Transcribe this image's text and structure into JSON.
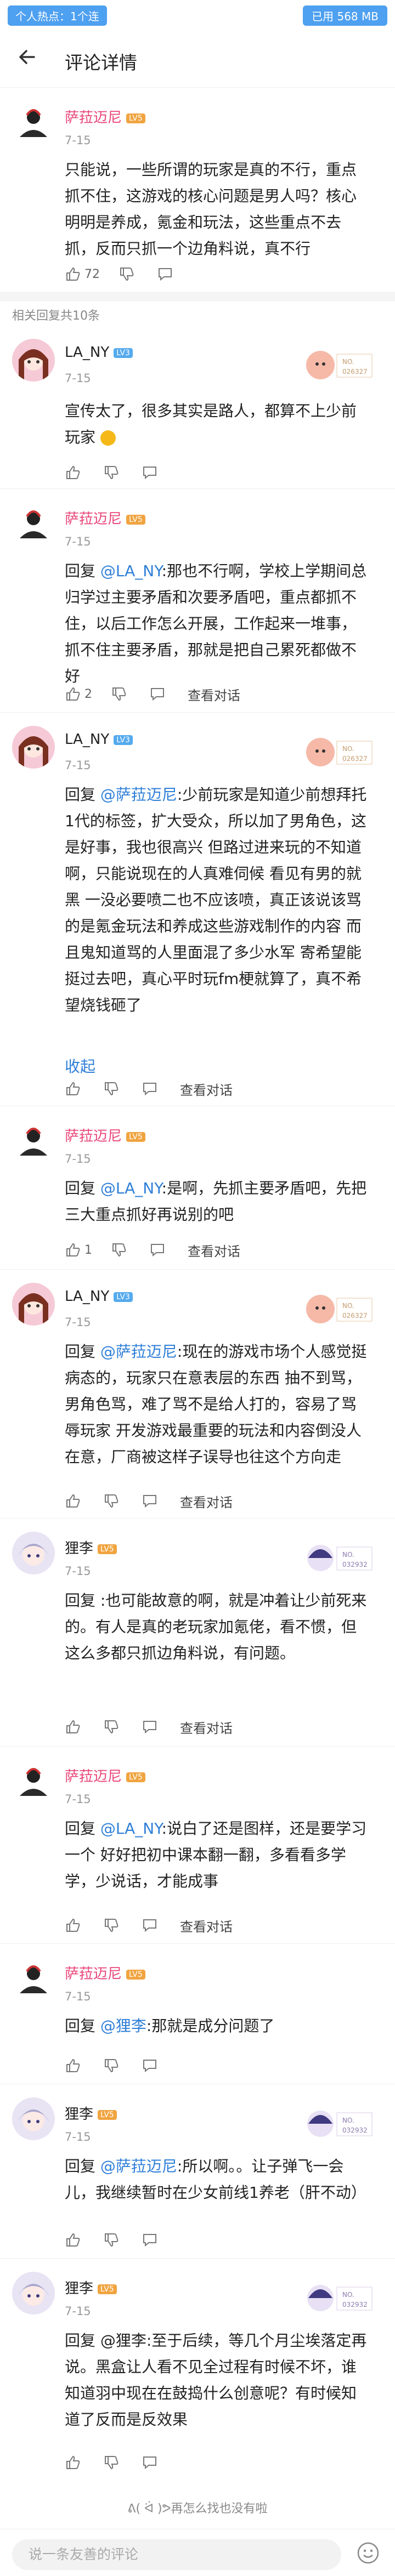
{
  "statusbar": {
    "left": "个人热点：1个连",
    "right": "已用 568 MB"
  },
  "header": {
    "title": "评论详情"
  },
  "main_comment": {
    "user": "萨菈迈尼",
    "level": "LV5",
    "date": "7-15",
    "text": "只能说，一些所谓的玩家是真的不行，重点抓不住，这游戏的核心问题是男人吗？核心明明是养成，氪金和玩法，这些重点不去抓，反而只抓一个边角料说，真不行",
    "likes": "72"
  },
  "replies_count_label": "相关回复共10条",
  "replies": [
    {
      "user": "LA_NY",
      "level": "LV3",
      "date": "7-15",
      "lines": [
        "宣传太了，很多其实是路人，都算不上少前",
        "玩家"
      ],
      "likes": "",
      "show_conv": false
    },
    {
      "user": "萨菈迈尼",
      "level": "LV5",
      "date": "7-15",
      "at": "@LA_NY",
      "prefix": "回复 ",
      "text": ":那也不行啊，学校上学期间总归学过主要矛盾和次要矛盾吧，重点都抓不住，以后工作怎么开展，工作起来一堆事，抓不住主要矛盾，那就是把自己累死都做不好",
      "likes": "2",
      "conv": "查看对话"
    },
    {
      "user": "LA_NY",
      "level": "LV3",
      "date": "7-15",
      "at": "@萨菈迈尼",
      "prefix": "回复 ",
      "text": ":少前玩家是知道少前想拜托1代的标签，扩大受众，所以加了男角色，这是好事，我也很高兴 但路过进来玩的不知道啊，只能说现在的人真难伺候 看见有男的就黑 一没必要喷二也不应该喷，真正该说该骂的是氪金玩法和养成这些游戏制作的内容 而且鬼知道骂的人里面混了多少水军 寄希望能挺过去吧，真心平时玩fm梗就算了，真不希望烧钱砸了",
      "collapse": "收起",
      "conv": "查看对话"
    },
    {
      "user": "萨菈迈尼",
      "level": "LV5",
      "date": "7-15",
      "at": "@LA_NY",
      "prefix": "回复 ",
      "text": ":是啊，先抓主要矛盾吧，先把三大重点抓好再说别的吧",
      "likes": "1",
      "conv": "查看对话"
    },
    {
      "user": "LA_NY",
      "level": "LV3",
      "date": "7-15",
      "at": "@萨菈迈尼",
      "prefix": "回复 ",
      "text": ":现在的游戏市场个人感觉挺病态的，玩家只在意表层的东西 抽不到骂，男角色骂，难了骂不是给人打的，容易了骂辱玩家 开发游戏最重要的玩法和内容倒没人在意，厂商被这样子误导也往这个方向走",
      "conv": "查看对话"
    },
    {
      "user": "狸李",
      "level": "LV5",
      "date": "7-15",
      "at": "",
      "prefix": "回复 ",
      "text": ":也可能故意的啊，就是冲着让少前死来的。有人是真的老玩家加氪佬，看不惯，但这么多都只抓边角料说，有问题。",
      "conv": "查看对话"
    },
    {
      "user": "萨菈迈尼",
      "level": "LV5",
      "date": "7-15",
      "at": "@LA_NY",
      "prefix": "回复 ",
      "text": ":说白了还是图样，还是要学习一个 好好把初中课本翻一翻，多看看多学学，少说话，才能成事",
      "conv": "查看对话"
    },
    {
      "user": "萨菈迈尼",
      "level": "LV5",
      "date": "7-15",
      "at": "@狸李",
      "prefix": "回复 ",
      "text": ":那就是成分问题了",
      "conv": ""
    },
    {
      "user": "狸李",
      "level": "LV5",
      "date": "7-15",
      "at": "@萨菈迈尼",
      "prefix": "回复 ",
      "text": ":所以啊。。让子弹飞一会儿，我继续暂时在少女前线1养老（肝不动）",
      "conv": ""
    },
    {
      "user": "狸李",
      "level": "LV5",
      "date": "7-15",
      "at": "",
      "prefix": "回复 @狸李",
      "text": ":至于后续，等几个月尘埃落定再说。黑盒让人看不见全过程有时候不坏，谁知道羽中现在在鼓捣什么创意呢？有时候知道了反而是反效果",
      "conv": ""
    }
  ],
  "footer": {
    "end_note": "ᕕ( ᐛ )ᕗ再怎么找也没有啦",
    "input_placeholder": "说一条友善的评论"
  },
  "labels": {
    "view_conversation": "查看对话",
    "collapse": "收起"
  },
  "colors": {
    "accent": "#2f7fd8",
    "status": "#4ea0f0"
  }
}
